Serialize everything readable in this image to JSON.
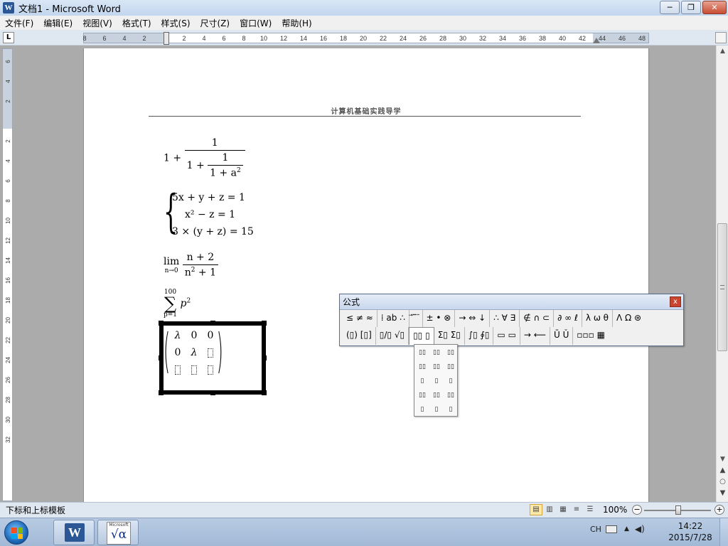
{
  "window": {
    "title": "文档1 - Microsoft Word",
    "minimize": "─",
    "maximize": "❐",
    "close": "✕"
  },
  "menu": [
    "文件(F)",
    "编辑(E)",
    "视图(V)",
    "格式(T)",
    "样式(S)",
    "尺寸(Z)",
    "窗口(W)",
    "帮助(H)"
  ],
  "ruler": {
    "tab_selector": "L",
    "ticks": [
      "8",
      "6",
      "4",
      "2",
      "",
      "2",
      "4",
      "6",
      "8",
      "10",
      "12",
      "14",
      "16",
      "18",
      "20",
      "22",
      "24",
      "26",
      "28",
      "30",
      "32",
      "34",
      "36",
      "38",
      "40",
      "42",
      "44",
      "46",
      "48"
    ],
    "vticks": [
      "6",
      "4",
      "2",
      "",
      "2",
      "4",
      "6",
      "8",
      "10",
      "12",
      "14",
      "16",
      "18",
      "20",
      "22",
      "24",
      "26",
      "28",
      "30",
      "32"
    ]
  },
  "document": {
    "header": "计算机基础实践导学",
    "eq1": {
      "one": "1",
      "plus": "+",
      "num": "1",
      "inner_one": "1",
      "inner_plus": "+",
      "inner_num": "1",
      "inner_den": "1 + a",
      "exp": "2"
    },
    "eq2": {
      "row1": "5x + y + z  = 1",
      "row2": "x² − z  = 1",
      "row3": "3 × (y + z) = 15"
    },
    "eq3": {
      "lim": "lim",
      "sub": "n→0",
      "num": "n + 2",
      "den": "n",
      "den_exp": "2",
      "den_rest": "+ 1"
    },
    "eq4": {
      "upper": "100",
      "sigma": "∑",
      "lower": "p=1",
      "body": "p",
      "exp": "2"
    },
    "matrix": {
      "cells": [
        "λ",
        "0",
        "0",
        "0",
        "λ",
        "",
        "",
        "",
        ""
      ]
    }
  },
  "equation_toolbar": {
    "title": "公式",
    "close": "x",
    "row1": [
      "≤ ≠ ≈",
      "⁞ ab ∴",
      "⃗ ⃛ ⃜",
      "± • ⊗",
      "→ ⇔ ↓",
      "∴ ∀ ∃",
      "∉ ∩ ⊂",
      "∂ ∞ ℓ",
      "λ ω θ",
      "Λ Ω ⊛"
    ],
    "row2": [
      "(▯) [▯]",
      "▯/▯ √▯",
      "▯▯ ▯",
      "Σ▯ Σ▯",
      "∫▯ ∮▯",
      "▭ ▭",
      "→ ⟵",
      "Ū Ǔ",
      "▫▫▫ ▦"
    ],
    "dropdown": [
      "▯▯",
      "▯▯",
      "▯▯",
      "▯▯",
      "▯▯",
      "▯▯",
      "▯",
      "▯",
      "▯",
      "▯▯",
      "▯▯",
      "▯▯",
      "▯",
      "▯",
      "▯"
    ]
  },
  "status": {
    "text": "下标和上标模板",
    "zoom": "100%",
    "minus": "−",
    "plus": "+"
  },
  "taskbar": {
    "word_label": "W",
    "eq_ms": "Microsoft",
    "eq_sym": "√α",
    "tray_lang": "CH",
    "time": "14:22",
    "date": "2015/7/28"
  }
}
